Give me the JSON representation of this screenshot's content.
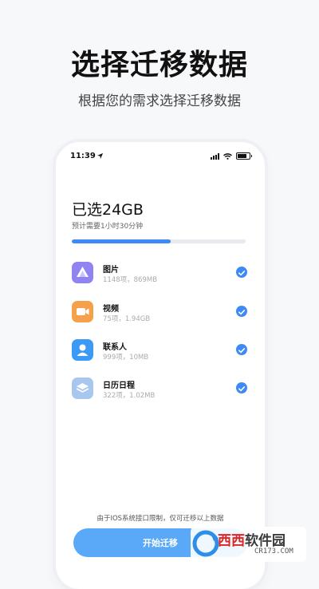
{
  "hero": {
    "title": "选择迁移数据",
    "subtitle": "根据您的需求选择迁移数据"
  },
  "status_bar": {
    "time": "11:39"
  },
  "summary": {
    "selected": "已选24GB",
    "estimate": "预计需要1小时30分钟",
    "progress_fraction": 0.57
  },
  "items": [
    {
      "name": "图片",
      "meta": "1148项，869MB",
      "icon": "photos-icon",
      "color": "#8f84f2",
      "checked": true
    },
    {
      "name": "视频",
      "meta": "75项，1.94GB",
      "icon": "video-icon",
      "color": "#f5a04a",
      "checked": true
    },
    {
      "name": "联系人",
      "meta": "999项，10MB",
      "icon": "contacts-icon",
      "color": "#3b9af5",
      "checked": true
    },
    {
      "name": "日历日程",
      "meta": "322项，1.02MB",
      "icon": "calendar-icon",
      "color": "#a8c7ef",
      "checked": true
    }
  ],
  "notice": "由于IOS系统接口限制，仅可迁移以上数据",
  "start_button": {
    "label": "开始迁移"
  },
  "watermark": {
    "brand_red": "西西",
    "brand_dark": "软件园",
    "domain": "CR173.COM"
  },
  "colors": {
    "accent": "#3d8af7",
    "button": "#5aa8f8"
  }
}
